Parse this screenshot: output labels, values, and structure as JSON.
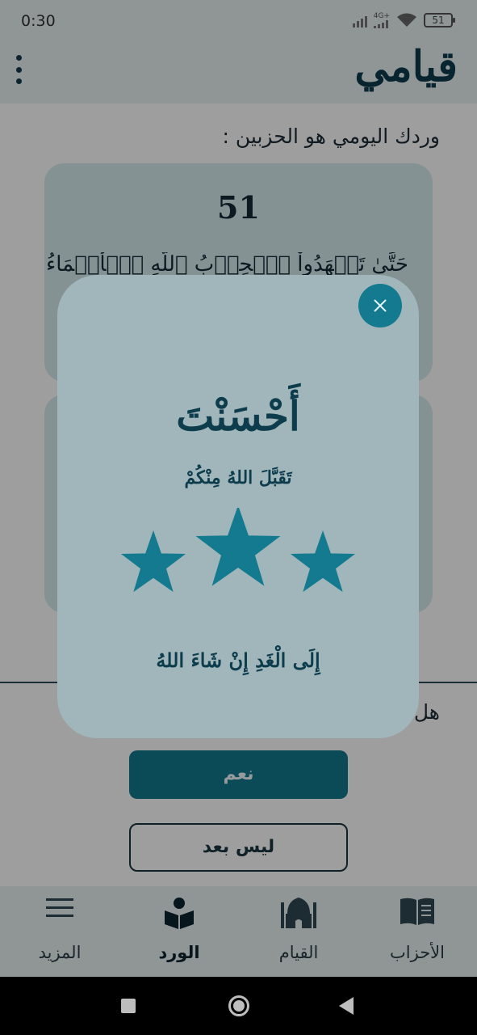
{
  "status_bar": {
    "time": "0:30",
    "network_type": "4G+",
    "battery": "51"
  },
  "app": {
    "title": "قيامي"
  },
  "main": {
    "wird_label": "وردك اليومي هو الحزبين :",
    "cards": [
      {
        "number": "51",
        "verse": "حَتَّىٰ تَشۡهَدُواْ ٱلۡحِزۡبُ ٱللَّهِ ٱلۡأَسۡمَاءُ إِذْ ٢ جِ"
      },
      {
        "number": "",
        "verse": ""
      }
    ],
    "question": "هل",
    "yes_label": "نعم",
    "not_yet_label": "ليس بعد"
  },
  "dialog": {
    "title": "أَحْسَنْتَ",
    "subtitle": "تَقَبَّلَ اللهُ مِنْكُمْ",
    "rating": 3,
    "rating_max": 3,
    "footer": "إِلَى الْغَدِ إِنْ شَاءَ اللهُ",
    "accent_color": "#137a8f"
  },
  "bottom_nav": {
    "items": [
      {
        "label": "المزيد",
        "icon": "menu-icon"
      },
      {
        "label": "الورد",
        "icon": "reading-icon"
      },
      {
        "label": "القيام",
        "icon": "mosque-icon"
      },
      {
        "label": "الأحزاب",
        "icon": "book-icon"
      }
    ],
    "active_index": 1
  }
}
